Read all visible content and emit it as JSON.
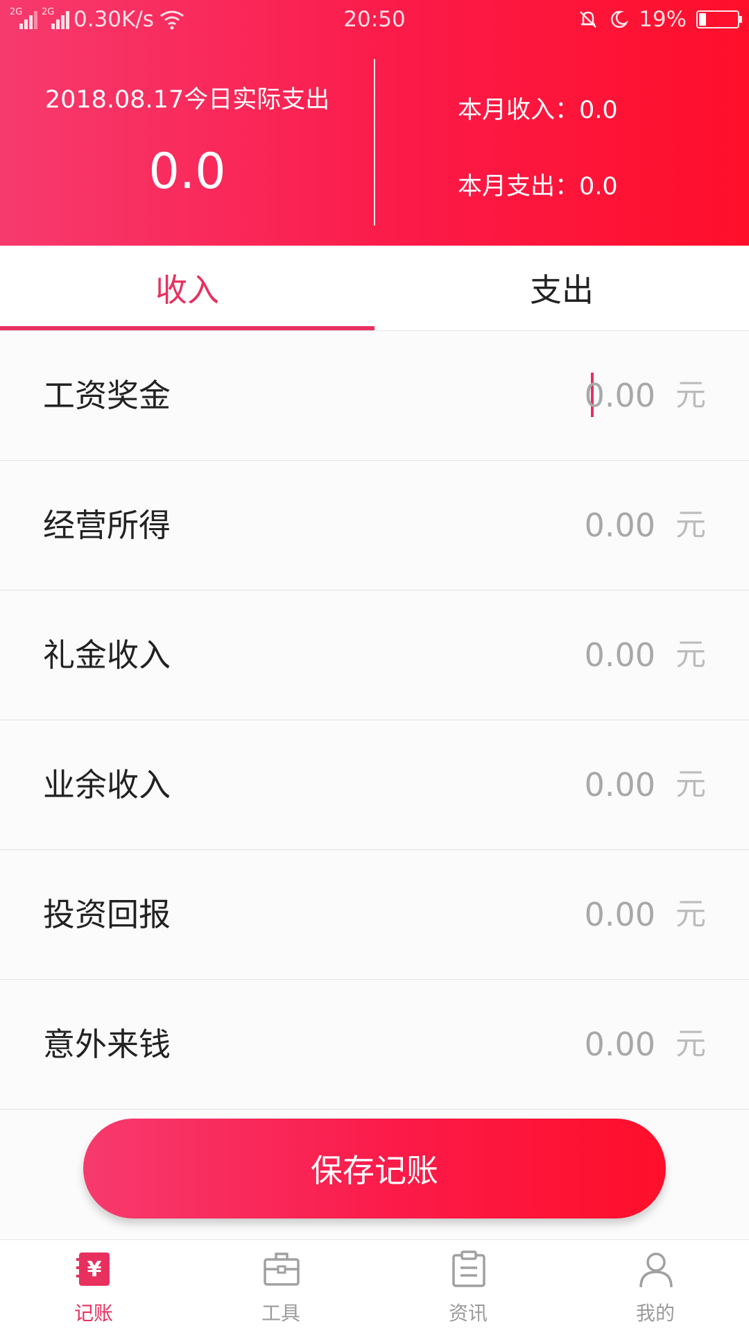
{
  "status_bar": {
    "network_1": "2G",
    "network_2": "2G",
    "speed": "0.30K/s",
    "time": "20:50",
    "battery": "19%"
  },
  "header": {
    "date_label": "2018.08.17今日实际支出",
    "today_amount": "0.0",
    "month_income_label": "本月收入：",
    "month_income_value": "0.0",
    "month_expense_label": "本月支出：",
    "month_expense_value": "0.0"
  },
  "tabs": [
    {
      "label": "收入",
      "active": true
    },
    {
      "label": "支出",
      "active": false
    }
  ],
  "income_items": [
    {
      "label": "工资奖金",
      "value": "0.00",
      "unit": "元"
    },
    {
      "label": "经营所得",
      "value": "0.00",
      "unit": "元"
    },
    {
      "label": "礼金收入",
      "value": "0.00",
      "unit": "元"
    },
    {
      "label": "业余收入",
      "value": "0.00",
      "unit": "元"
    },
    {
      "label": "投资回报",
      "value": "0.00",
      "unit": "元"
    },
    {
      "label": "意外来钱",
      "value": "0.00",
      "unit": "元"
    }
  ],
  "save_button": "保存记账",
  "bottom_nav": [
    {
      "label": "记账",
      "icon": "ledger-icon",
      "active": true
    },
    {
      "label": "工具",
      "icon": "toolbox-icon",
      "active": false
    },
    {
      "label": "资讯",
      "icon": "clipboard-icon",
      "active": false
    },
    {
      "label": "我的",
      "icon": "user-icon",
      "active": false
    }
  ],
  "colors": {
    "accent": "#e8305f",
    "gradient_start": "#f73a6e",
    "gradient_end": "#ff0f2a"
  }
}
